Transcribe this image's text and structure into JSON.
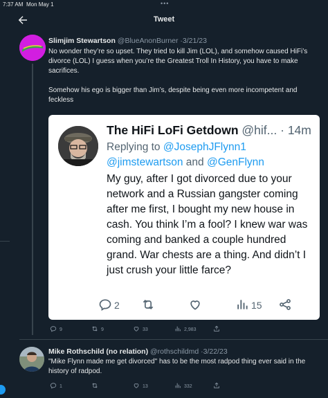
{
  "status": {
    "time": "7:37 AM",
    "date": "Mon May 1"
  },
  "header": {
    "title": "Tweet"
  },
  "tweet": {
    "author_name": "Slimjim Stewartson",
    "handle": "@BlueAnonBurner",
    "date": "3/21/23",
    "paragraphs": [
      "No wonder they’re so upset. They tried to kill Jim (LOL), and somehow caused HiFi’s divorce (LOL) I guess when you’re the Greatest Troll In History, you have to make sacrifices.",
      "Somehow his ego is bigger than Jim’s, despite being even more incompetent and feckless"
    ],
    "stats": {
      "replies": "9",
      "retweets": "9",
      "likes": "33",
      "views": "2,983"
    }
  },
  "embedded": {
    "author_name": "The HiFi LoFi Getdown",
    "handle": "@hif...",
    "time": "14m",
    "replying_to_label": "Replying to",
    "reply_handle_1": "@JosephJFlynn1",
    "reply_handle_2": "@jimstewartson",
    "reply_and": "and",
    "reply_handle_3": "@GenFlynn",
    "body": "My guy, after I got divorced due to your network and a Russian gangster coming after me first, I bought my new house in cash. You think I’m a fool? I knew war was coming and banked a couple hundred grand. War chests are a thing. And didn’t I just crush your little farce?",
    "stats": {
      "replies": "2",
      "views": "15"
    }
  },
  "reply": {
    "author_name": "Mike Rothschild (no relation)",
    "handle": "@rothschildmd",
    "date": "3/22/23",
    "body": "\"Mike Flynn made me get divorced\" has to be the most radpod thing ever said in the history of radpod.",
    "stats": {
      "replies": "1",
      "likes": "13",
      "views": "332"
    }
  },
  "colors": {
    "background": "#15202b",
    "accent": "#1d9bf0",
    "muted": "#8b98a5",
    "avatar_pink": "#d21ee0"
  }
}
